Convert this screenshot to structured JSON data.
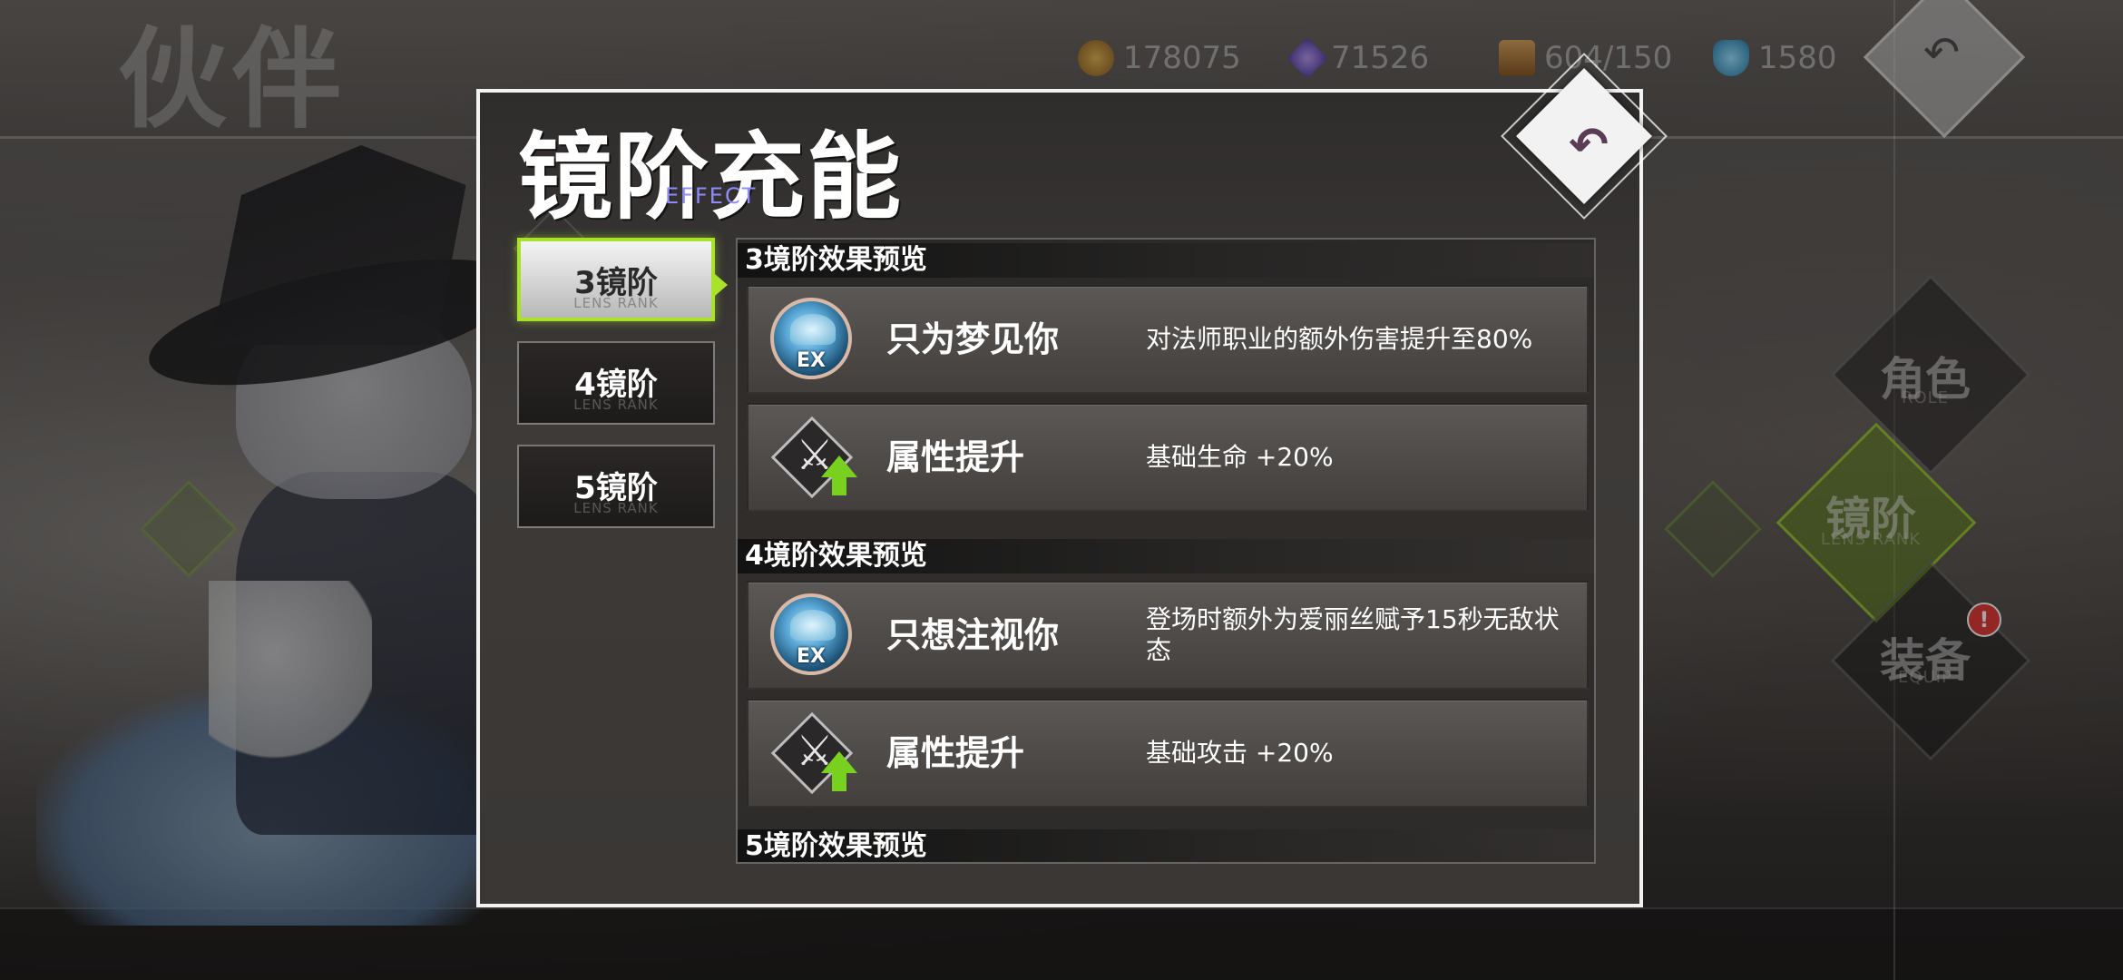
{
  "background": {
    "page_title": "伙伴",
    "resources": [
      {
        "icon": "gold-coin-icon",
        "value": "178075",
        "color": "#c9953a"
      },
      {
        "icon": "purple-crystal-icon",
        "value": "71526",
        "color": "#8d6be0"
      },
      {
        "icon": "supply-box-icon",
        "value": "604/150",
        "color": "#c08a4a"
      },
      {
        "icon": "blue-diamond-icon",
        "value": "1580",
        "color": "#3fa6d8"
      }
    ],
    "side_nav": [
      {
        "label": "角色",
        "sub": "ROLE",
        "active": false
      },
      {
        "label": "镜阶",
        "sub": "LENS RANK",
        "active": true
      },
      {
        "label": "装备",
        "sub": "EQUIP",
        "active": false,
        "alert": "!"
      }
    ]
  },
  "modal": {
    "title": "镜阶充能",
    "subtitle": "EFFECT",
    "close_icon": "undo-arrow-icon",
    "tabs": [
      {
        "label": "3镜阶",
        "sub": "LENS RANK",
        "active": true
      },
      {
        "label": "4镜阶",
        "sub": "LENS RANK",
        "active": false
      },
      {
        "label": "5镜阶",
        "sub": "LENS RANK",
        "active": false
      }
    ],
    "sections": [
      {
        "header": "3境阶效果预览",
        "rows": [
          {
            "icon": "ex-skill-icon",
            "badge": "EX",
            "name": "只为梦见你",
            "desc": "对法师职业的额外伤害提升至80%"
          },
          {
            "icon": "attribute-up-icon",
            "name": "属性提升",
            "desc": "基础生命 +20%"
          }
        ]
      },
      {
        "header": "4境阶效果预览",
        "rows": [
          {
            "icon": "ex-skill-icon",
            "badge": "EX",
            "name": "只想注视你",
            "desc": "登场时额外为爱丽丝赋予15秒无敌状态"
          },
          {
            "icon": "attribute-up-icon",
            "name": "属性提升",
            "desc": "基础攻击 +20%"
          }
        ]
      },
      {
        "header": "5境阶效果预览",
        "rows": []
      }
    ],
    "accent_color": "#a9e22a"
  }
}
